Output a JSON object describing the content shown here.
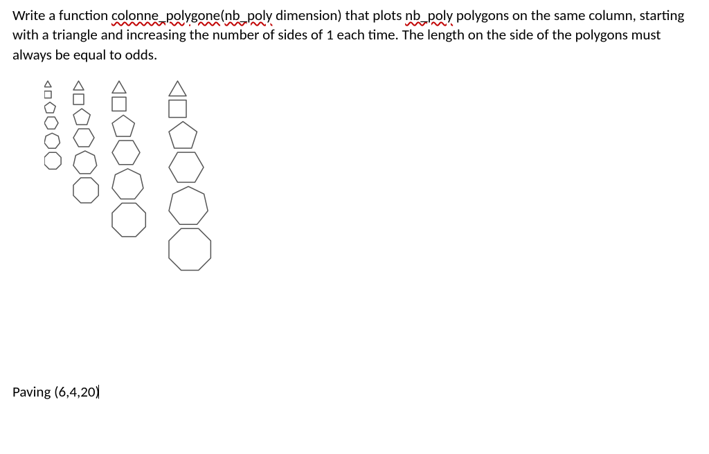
{
  "paragraph": {
    "t1": "Write a function ",
    "s1": "colonne_polygone",
    "t2": "(",
    "s2": "nb_poly",
    "t3": " dimension) that plots ",
    "s3": "nb_poly",
    "t4": " polygons on the same column, starting with a triangle and increasing the number of sides of 1 each time. The length on the side of the polygons must always be equal to odds."
  },
  "caption": "Paving (6,4,20)",
  "polygon_svg": {
    "stroke": "#555555",
    "stroke_width": 1.5
  },
  "chart_data": {
    "type": "diagram",
    "title": "Polygon columns example",
    "description": "Four columns of polygons. Each column stacks polygons with side counts 3..8. Columns progressively larger side length.",
    "columns": [
      {
        "side_length_relative": 1,
        "polygons": [
          3,
          4,
          5,
          6,
          7,
          8
        ]
      },
      {
        "side_length_relative": 1.5,
        "polygons": [
          3,
          4,
          5,
          6,
          7,
          8
        ]
      },
      {
        "side_length_relative": 2,
        "polygons": [
          3,
          4,
          5,
          6,
          7,
          8
        ]
      },
      {
        "side_length_relative": 2.5,
        "polygons": [
          3,
          4,
          5,
          6,
          7,
          8
        ]
      }
    ]
  }
}
